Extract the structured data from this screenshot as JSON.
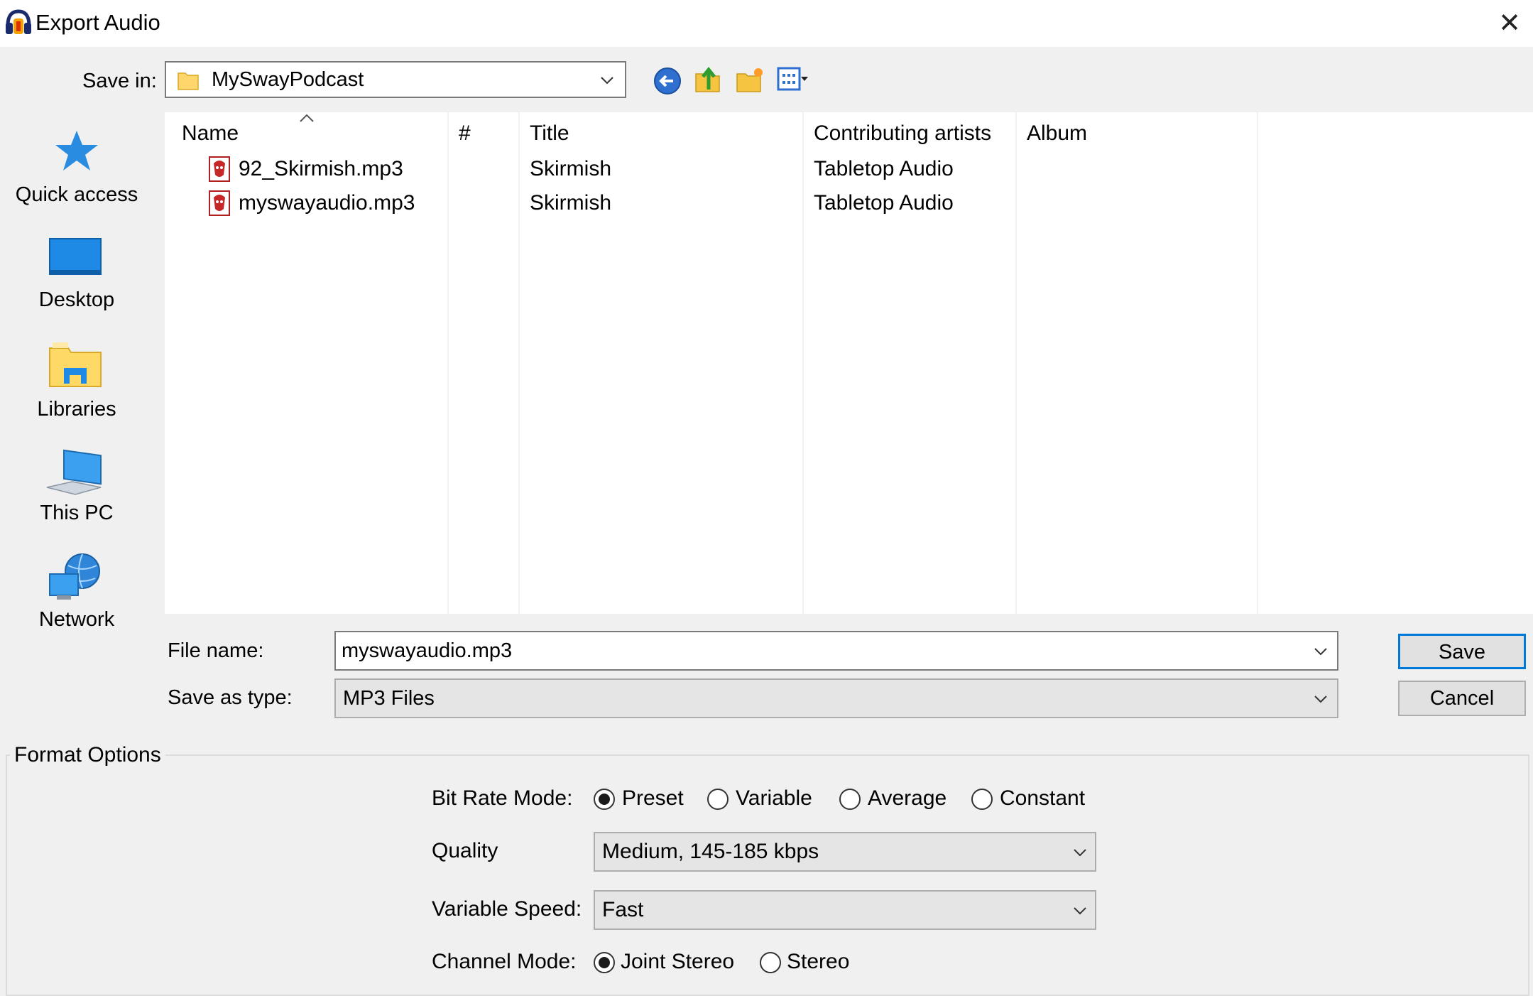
{
  "window": {
    "title": "Export Audio",
    "close_glyph": "✕"
  },
  "save_in": {
    "label": "Save in:",
    "value": "MySwayPodcast",
    "toolbar_icons": [
      "back-arrow-icon",
      "up-folder-icon",
      "new-folder-icon",
      "view-menu-icon"
    ]
  },
  "places": [
    {
      "label": "Quick access",
      "icon": "quick-access-star-icon"
    },
    {
      "label": "Desktop",
      "icon": "desktop-icon"
    },
    {
      "label": "Libraries",
      "icon": "libraries-icon"
    },
    {
      "label": "This PC",
      "icon": "this-pc-icon"
    },
    {
      "label": "Network",
      "icon": "network-icon"
    }
  ],
  "file_list": {
    "columns": [
      "Name",
      "#",
      "Title",
      "Contributing artists",
      "Album"
    ],
    "sort_indicator": "^",
    "rows": [
      {
        "name": "92_Skirmish.mp3",
        "number": "",
        "title": "Skirmish",
        "artists": "Tabletop Audio",
        "album": ""
      },
      {
        "name": "myswayaudio.mp3",
        "number": "",
        "title": "Skirmish",
        "artists": "Tabletop Audio",
        "album": ""
      }
    ]
  },
  "file_name": {
    "label": "File name:",
    "value": "myswayaudio.mp3"
  },
  "save_as_type": {
    "label": "Save as type:",
    "value": "MP3 Files"
  },
  "buttons": {
    "save": "Save",
    "cancel": "Cancel"
  },
  "format_options": {
    "title": "Format Options",
    "bit_rate_mode": {
      "label": "Bit Rate Mode:",
      "options": [
        "Preset",
        "Variable",
        "Average",
        "Constant"
      ],
      "selected": "Preset"
    },
    "quality": {
      "label": "Quality",
      "value": "Medium, 145-185 kbps"
    },
    "variable_speed": {
      "label": "Variable Speed:",
      "value": "Fast"
    },
    "channel_mode": {
      "label": "Channel Mode:",
      "options": [
        "Joint Stereo",
        "Stereo"
      ],
      "selected": "Joint Stereo"
    }
  },
  "colors": {
    "accent": "#0078d7",
    "dialog_bg": "#f0f0f0",
    "list_bg": "#ffffff"
  }
}
